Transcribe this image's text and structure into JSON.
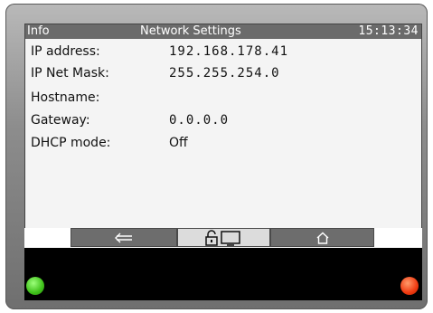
{
  "titlebar": {
    "left": "Info",
    "title": "Network Settings",
    "time": "15:13:34"
  },
  "fields": [
    {
      "label": "IP address:",
      "value": "192.168.178.41"
    },
    {
      "label": "IP Net Mask:",
      "value": "255.255.254.0"
    },
    {
      "label": "Hostname:",
      "value": ""
    },
    {
      "label": "Gateway:",
      "value": "0.0.0.0"
    },
    {
      "label": "DHCP mode:",
      "value": "Off"
    }
  ],
  "navbar": {
    "buttons": [
      {
        "icon": "back-arrow-icon"
      },
      {
        "icon": "unlock-display-icon"
      },
      {
        "icon": "home-icon"
      }
    ]
  },
  "indicators": {
    "left_color": "#3fc11a",
    "right_color": "#f03a10"
  }
}
